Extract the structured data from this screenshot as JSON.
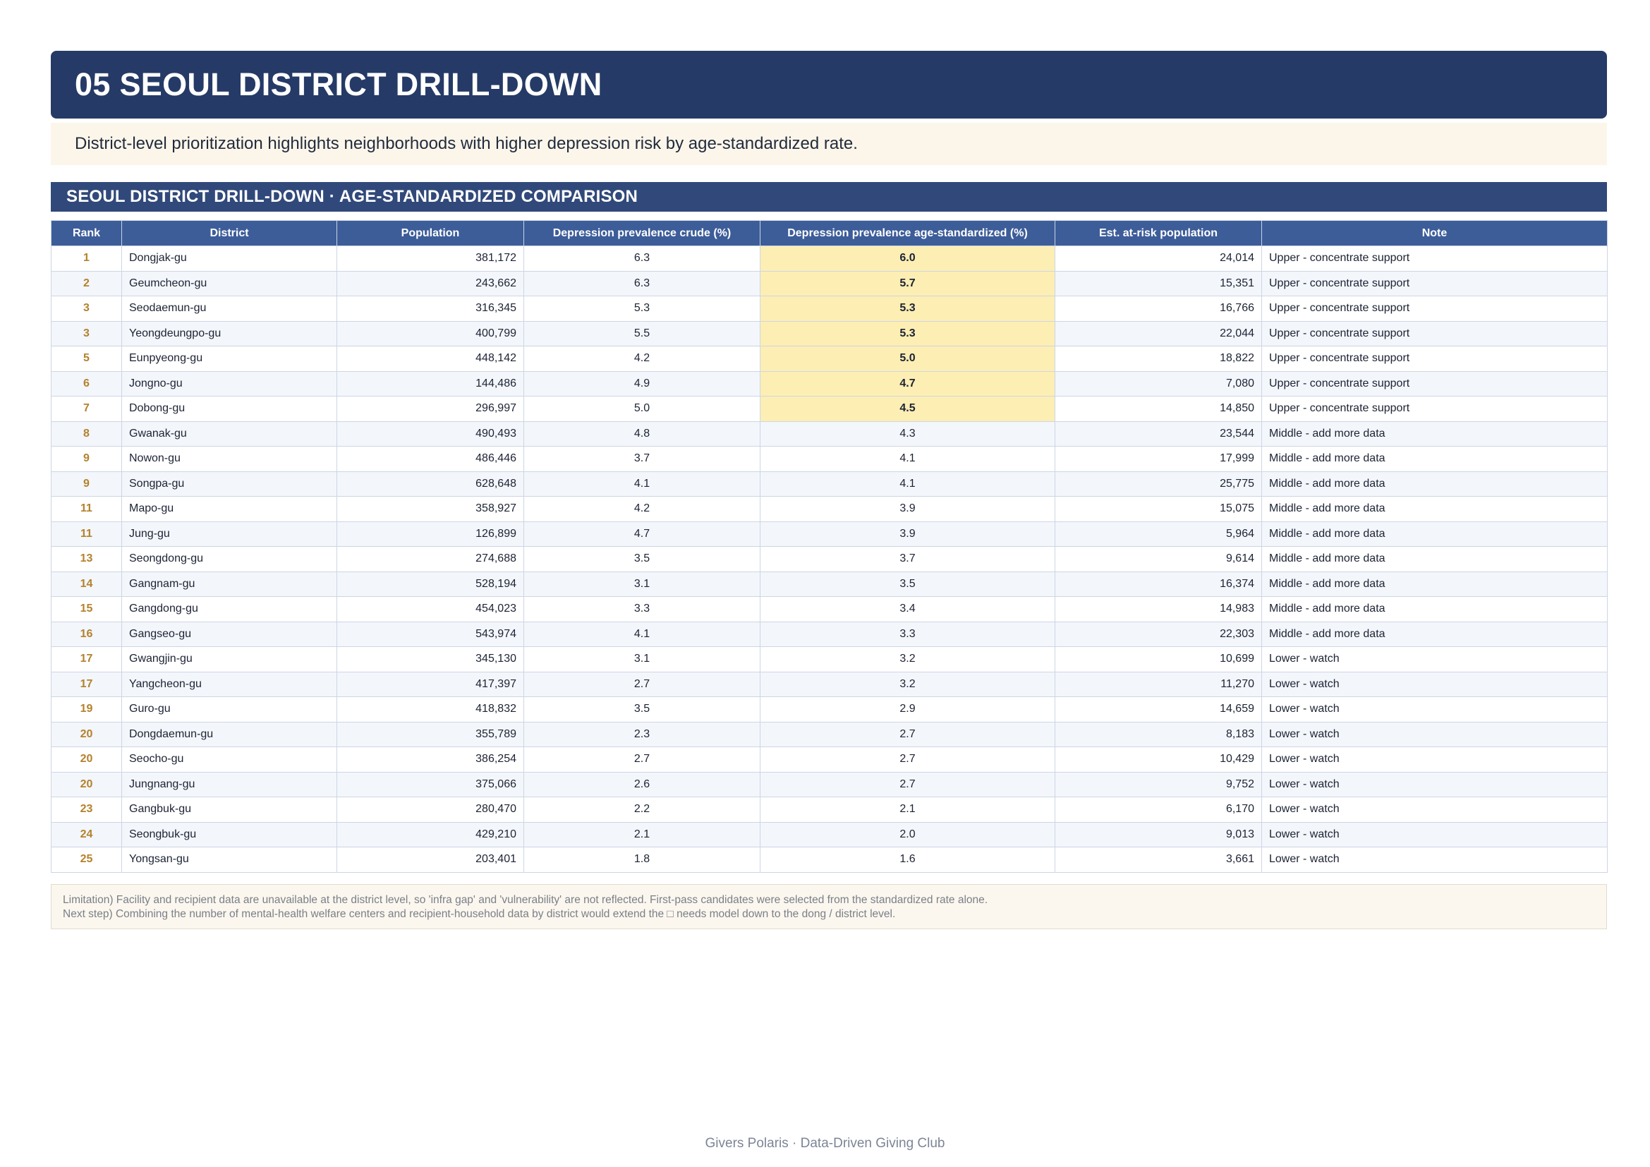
{
  "header": {
    "title": "05 SEOUL DISTRICT DRILL-DOWN",
    "subtitle": "District-level prioritization highlights neighborhoods with higher depression risk by age-standardized rate."
  },
  "section": {
    "title": "SEOUL DISTRICT DRILL-DOWN · AGE-STANDARDIZED COMPARISON"
  },
  "table": {
    "columns": [
      "Rank",
      "District",
      "Population",
      "Depression prevalence crude (%)",
      "Depression prevalence age-standardized (%)",
      "Est. at-risk population",
      "Note"
    ],
    "highlight_color": "#fdeeb4",
    "rows": [
      {
        "rank": "1",
        "district": "Dongjak-gu",
        "population": "381,172",
        "crude": "6.3",
        "std": "6.0",
        "at_risk": "24,014",
        "note": "Upper - concentrate support",
        "highlight": true
      },
      {
        "rank": "2",
        "district": "Geumcheon-gu",
        "population": "243,662",
        "crude": "6.3",
        "std": "5.7",
        "at_risk": "15,351",
        "note": "Upper - concentrate support",
        "highlight": true
      },
      {
        "rank": "3",
        "district": "Seodaemun-gu",
        "population": "316,345",
        "crude": "5.3",
        "std": "5.3",
        "at_risk": "16,766",
        "note": "Upper - concentrate support",
        "highlight": true
      },
      {
        "rank": "3",
        "district": "Yeongdeungpo-gu",
        "population": "400,799",
        "crude": "5.5",
        "std": "5.3",
        "at_risk": "22,044",
        "note": "Upper - concentrate support",
        "highlight": true
      },
      {
        "rank": "5",
        "district": "Eunpyeong-gu",
        "population": "448,142",
        "crude": "4.2",
        "std": "5.0",
        "at_risk": "18,822",
        "note": "Upper - concentrate support",
        "highlight": true
      },
      {
        "rank": "6",
        "district": "Jongno-gu",
        "population": "144,486",
        "crude": "4.9",
        "std": "4.7",
        "at_risk": "7,080",
        "note": "Upper - concentrate support",
        "highlight": true
      },
      {
        "rank": "7",
        "district": "Dobong-gu",
        "population": "296,997",
        "crude": "5.0",
        "std": "4.5",
        "at_risk": "14,850",
        "note": "Upper - concentrate support",
        "highlight": true
      },
      {
        "rank": "8",
        "district": "Gwanak-gu",
        "population": "490,493",
        "crude": "4.8",
        "std": "4.3",
        "at_risk": "23,544",
        "note": "Middle - add more data",
        "highlight": false
      },
      {
        "rank": "9",
        "district": "Nowon-gu",
        "population": "486,446",
        "crude": "3.7",
        "std": "4.1",
        "at_risk": "17,999",
        "note": "Middle - add more data",
        "highlight": false
      },
      {
        "rank": "9",
        "district": "Songpa-gu",
        "population": "628,648",
        "crude": "4.1",
        "std": "4.1",
        "at_risk": "25,775",
        "note": "Middle - add more data",
        "highlight": false
      },
      {
        "rank": "11",
        "district": "Mapo-gu",
        "population": "358,927",
        "crude": "4.2",
        "std": "3.9",
        "at_risk": "15,075",
        "note": "Middle - add more data",
        "highlight": false
      },
      {
        "rank": "11",
        "district": "Jung-gu",
        "population": "126,899",
        "crude": "4.7",
        "std": "3.9",
        "at_risk": "5,964",
        "note": "Middle - add more data",
        "highlight": false
      },
      {
        "rank": "13",
        "district": "Seongdong-gu",
        "population": "274,688",
        "crude": "3.5",
        "std": "3.7",
        "at_risk": "9,614",
        "note": "Middle - add more data",
        "highlight": false
      },
      {
        "rank": "14",
        "district": "Gangnam-gu",
        "population": "528,194",
        "crude": "3.1",
        "std": "3.5",
        "at_risk": "16,374",
        "note": "Middle - add more data",
        "highlight": false
      },
      {
        "rank": "15",
        "district": "Gangdong-gu",
        "population": "454,023",
        "crude": "3.3",
        "std": "3.4",
        "at_risk": "14,983",
        "note": "Middle - add more data",
        "highlight": false
      },
      {
        "rank": "16",
        "district": "Gangseo-gu",
        "population": "543,974",
        "crude": "4.1",
        "std": "3.3",
        "at_risk": "22,303",
        "note": "Middle - add more data",
        "highlight": false
      },
      {
        "rank": "17",
        "district": "Gwangjin-gu",
        "population": "345,130",
        "crude": "3.1",
        "std": "3.2",
        "at_risk": "10,699",
        "note": "Lower - watch",
        "highlight": false
      },
      {
        "rank": "17",
        "district": "Yangcheon-gu",
        "population": "417,397",
        "crude": "2.7",
        "std": "3.2",
        "at_risk": "11,270",
        "note": "Lower - watch",
        "highlight": false
      },
      {
        "rank": "19",
        "district": "Guro-gu",
        "population": "418,832",
        "crude": "3.5",
        "std": "2.9",
        "at_risk": "14,659",
        "note": "Lower - watch",
        "highlight": false
      },
      {
        "rank": "20",
        "district": "Dongdaemun-gu",
        "population": "355,789",
        "crude": "2.3",
        "std": "2.7",
        "at_risk": "8,183",
        "note": "Lower - watch",
        "highlight": false
      },
      {
        "rank": "20",
        "district": "Seocho-gu",
        "population": "386,254",
        "crude": "2.7",
        "std": "2.7",
        "at_risk": "10,429",
        "note": "Lower - watch",
        "highlight": false
      },
      {
        "rank": "20",
        "district": "Jungnang-gu",
        "population": "375,066",
        "crude": "2.6",
        "std": "2.7",
        "at_risk": "9,752",
        "note": "Lower - watch",
        "highlight": false
      },
      {
        "rank": "23",
        "district": "Gangbuk-gu",
        "population": "280,470",
        "crude": "2.2",
        "std": "2.1",
        "at_risk": "6,170",
        "note": "Lower - watch",
        "highlight": false
      },
      {
        "rank": "24",
        "district": "Seongbuk-gu",
        "population": "429,210",
        "crude": "2.1",
        "std": "2.0",
        "at_risk": "9,013",
        "note": "Lower - watch",
        "highlight": false
      },
      {
        "rank": "25",
        "district": "Yongsan-gu",
        "population": "203,401",
        "crude": "1.8",
        "std": "1.6",
        "at_risk": "3,661",
        "note": "Lower - watch",
        "highlight": false
      }
    ]
  },
  "footnote": {
    "line1": "Limitation) Facility and recipient data are unavailable at the district level, so 'infra gap' and 'vulnerability' are not reflected. First-pass candidates were selected from the standardized rate alone.",
    "line2": "Next step) Combining the number of mental-health welfare centers and recipient-household data by district would extend the □ needs model down to the dong / district level."
  },
  "footer": {
    "text": "Givers Polaris · Data-Driven Giving Club"
  }
}
